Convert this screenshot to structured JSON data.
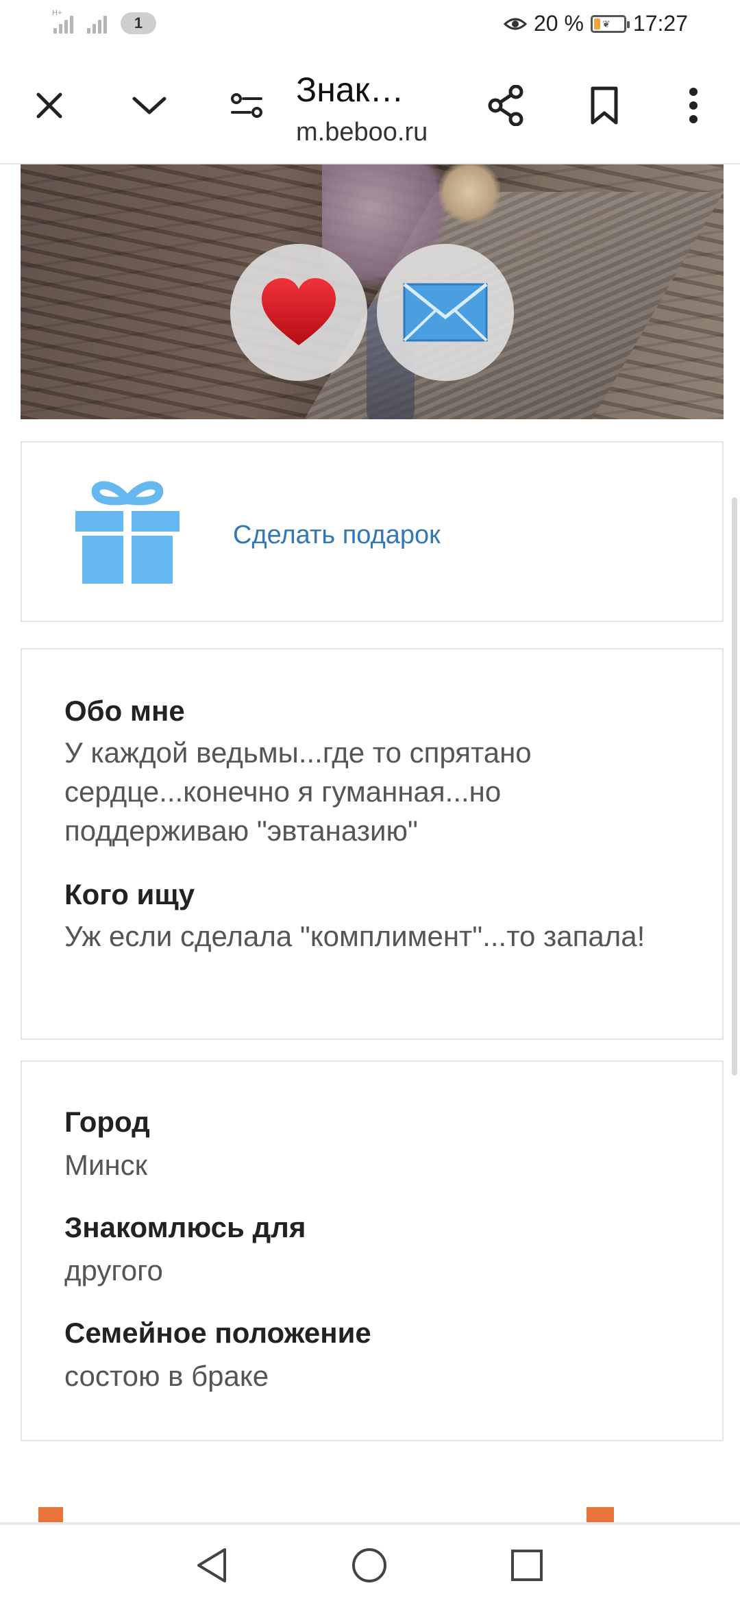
{
  "status_bar": {
    "network_type": "H+",
    "notification_count": "1",
    "battery_percent": "20 %",
    "battery_level": 0.2,
    "time": "17:27"
  },
  "toolbar": {
    "page_title": "Знак…",
    "url": "m.beboo.ru",
    "icons": [
      "close-icon",
      "chevron-down-icon",
      "page-settings-icon",
      "share-icon",
      "bookmark-icon",
      "more-icon"
    ]
  },
  "photo": {
    "like_icon": "heart-icon",
    "message_icon": "envelope-icon",
    "colors": {
      "heart": "#d8141c",
      "envelope": "#4a9fe0"
    }
  },
  "gift": {
    "link_label": "Сделать подарок",
    "icon": "gift-icon",
    "color": "#66b8f0"
  },
  "about": {
    "about_me_label": "Обо мне",
    "about_me_text": "У каждой ведьмы...где то спрятано сердце...конечно я гуманная...но поддерживаю \"эвтаназию\"",
    "looking_for_label": "Кого ищу",
    "looking_for_text": "Уж если сделала \"комплимент\"...то запала!"
  },
  "info": {
    "city_label": "Город",
    "city_value": "Минск",
    "purpose_label": "Знакомлюсь для",
    "purpose_value": "другого",
    "marital_label": "Семейное положение",
    "marital_value": "состою в браке"
  },
  "nav": {
    "icons": [
      "back-icon",
      "home-icon",
      "recents-icon"
    ]
  },
  "colors": {
    "link": "#3178b4",
    "accent_orange": "#e8743b"
  }
}
